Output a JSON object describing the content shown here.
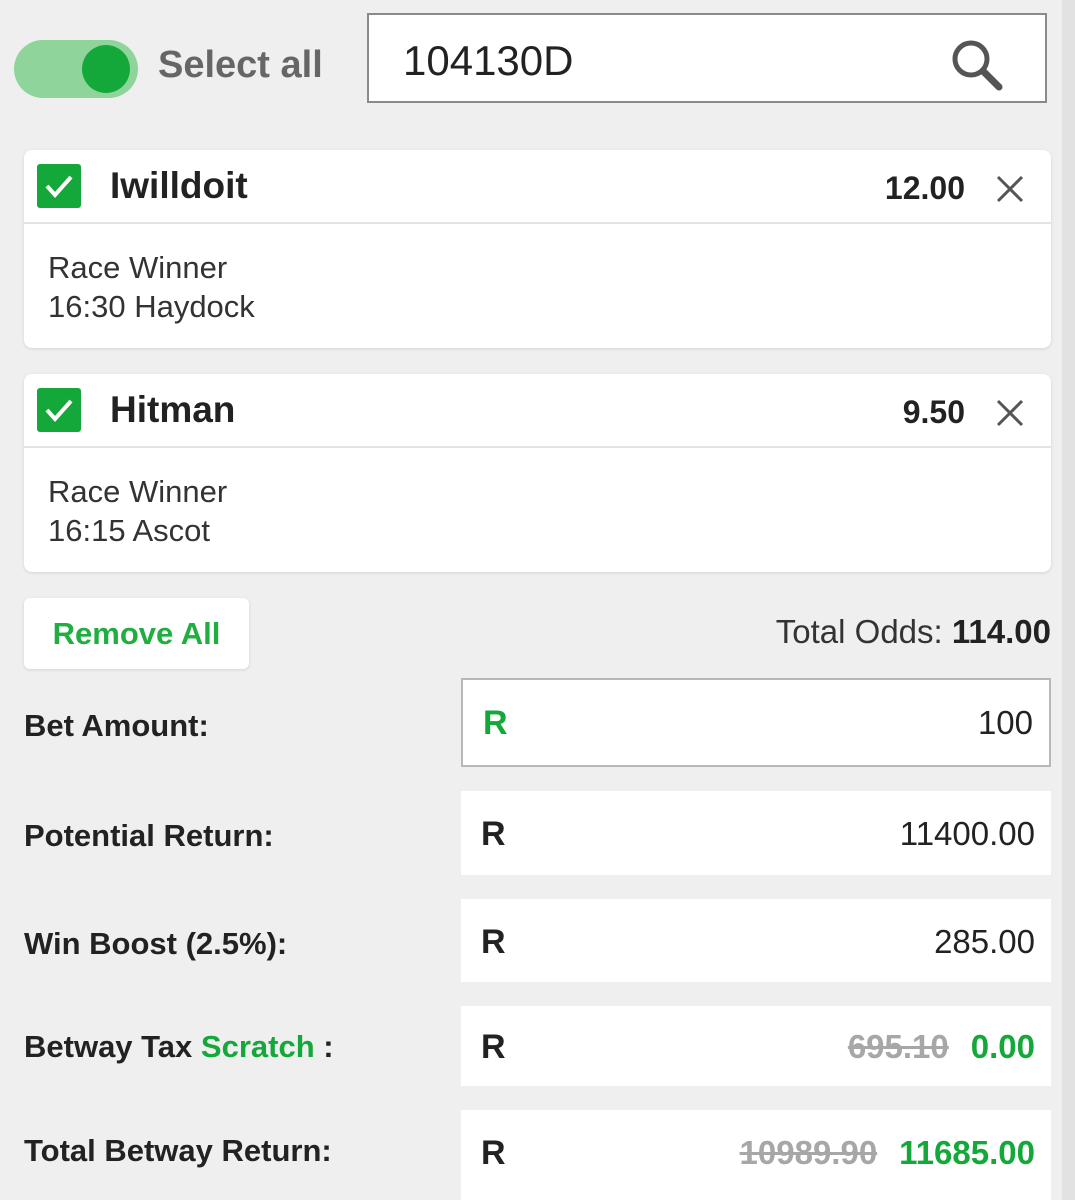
{
  "header": {
    "select_all_label": "Select all",
    "select_all_on": true,
    "search_value": "104130D"
  },
  "bets": [
    {
      "name": "Iwilldoit",
      "odds": "12.00",
      "market": "Race Winner",
      "event": "16:30 Haydock",
      "checked": true
    },
    {
      "name": "Hitman",
      "odds": "9.50",
      "market": "Race Winner",
      "event": "16:15 Ascot",
      "checked": true
    }
  ],
  "actions": {
    "remove_all_label": "Remove All"
  },
  "totals": {
    "total_odds_label": "Total Odds:",
    "total_odds_value": "114.00",
    "bet_amount_label": "Bet Amount:",
    "bet_amount_currency": "R",
    "bet_amount_value": "100",
    "potential_return_label": "Potential Return:",
    "potential_return_currency": "R",
    "potential_return_value": "11400.00",
    "win_boost_label": "Win Boost (2.5%):",
    "win_boost_currency": "R",
    "win_boost_value": "285.00",
    "tax_label_prefix": "Betway Tax",
    "tax_label_highlight": "Scratch",
    "tax_label_suffix": " :",
    "tax_currency": "R",
    "tax_old_value": "695.10",
    "tax_new_value": "0.00",
    "total_return_label": "Total Betway Return:",
    "total_return_currency": "R",
    "total_return_old_value": "10989.90",
    "total_return_new_value": "11685.00"
  },
  "colors": {
    "accent_green": "#14a83a",
    "toggle_track": "#8fd49a",
    "background": "#efefef"
  }
}
